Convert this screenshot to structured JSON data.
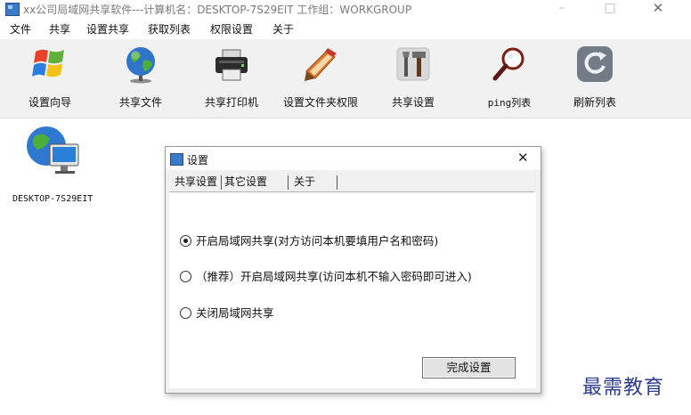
{
  "window": {
    "title": "xx公司局域网共享软件---计算机名：DESKTOP-7S29EIT  工作组：WORKGROUP",
    "minimize_glyph": "–",
    "maximize_glyph": "□",
    "close_glyph": "✕"
  },
  "menu": [
    "文件",
    "共享",
    "设置共享",
    "获取列表",
    "权限设置",
    "关于"
  ],
  "toolbar": {
    "items": [
      {
        "label": "设置向导",
        "icon": "windows-logo-icon"
      },
      {
        "label": "共享文件",
        "icon": "globe-icon"
      },
      {
        "label": "共享打印机",
        "icon": "printer-icon"
      },
      {
        "label": "设置文件夹权限",
        "icon": "folder-pencil-icon"
      },
      {
        "label": "共享设置",
        "icon": "tools-icon"
      },
      {
        "label": "ping列表",
        "icon": "magnifier-icon"
      },
      {
        "label": "刷新列表",
        "icon": "refresh-icon"
      }
    ]
  },
  "main": {
    "computer_label": "DESKTOP-7S29EIT"
  },
  "dialog": {
    "title": "设置",
    "close_glyph": "✕",
    "tabs": [
      "共享设置",
      "其它设置",
      "关于"
    ],
    "options": [
      {
        "label": "开启局域网共享(对方访问本机要填用户名和密码)",
        "selected": true
      },
      {
        "label": "（推荐）开启局域网共享(访问本机不输入密码即可进入)",
        "selected": false
      },
      {
        "label": "关闭局域网共享",
        "selected": false
      }
    ],
    "confirm_label": "完成设置"
  },
  "watermark": "最需教育"
}
